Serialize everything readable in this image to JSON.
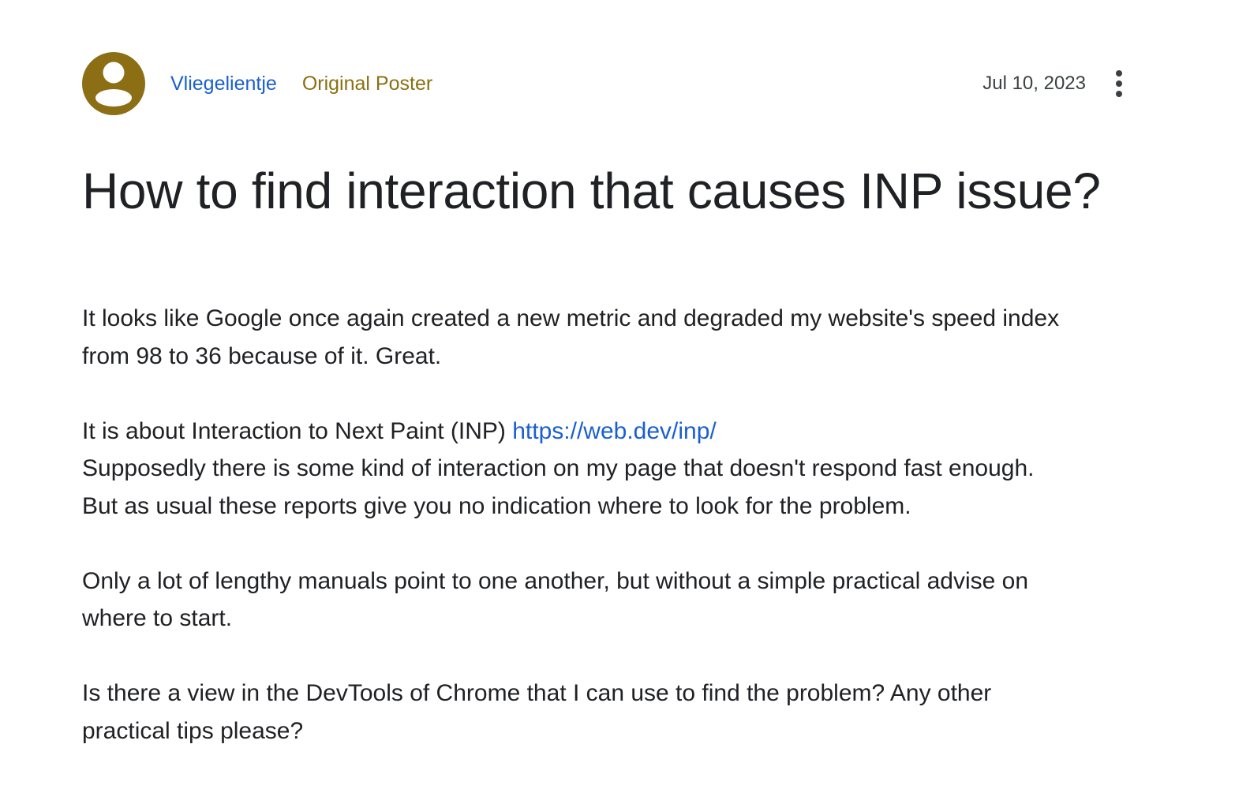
{
  "post": {
    "author": "Vliegelientje",
    "badge": "Original Poster",
    "date": "Jul 10, 2023",
    "more_icon": "more-vert-icon",
    "avatar_icon": "person-icon",
    "title": "How to find interaction that causes INP issue?",
    "paragraphs": {
      "p1_line1": "It looks like Google once again created a new metric and degraded my website's speed index",
      "p1_line2": "from 98 to 36 because of it. Great.",
      "p2_prefix": "It is about Interaction to Next Paint (INP) ",
      "p2_link": "https://web.dev/inp/",
      "p2_line2": "Supposedly there is some kind of interaction on my page that doesn't respond fast enough.",
      "p2_line3": "But as usual these reports give you no indication where to look for the problem.",
      "p3_line1": "Only a lot of lengthy manuals point to one another, but without a simple practical advise on",
      "p3_line2": "where to start.",
      "p4_line1": "Is there a view in the DevTools of Chrome that I can use to find the problem? Any other",
      "p4_line2": "practical tips please?"
    }
  },
  "colors": {
    "avatar_bg": "#8c6f15",
    "author_link": "#1a5fd0",
    "badge": "#8a6f12",
    "text": "#202124"
  }
}
